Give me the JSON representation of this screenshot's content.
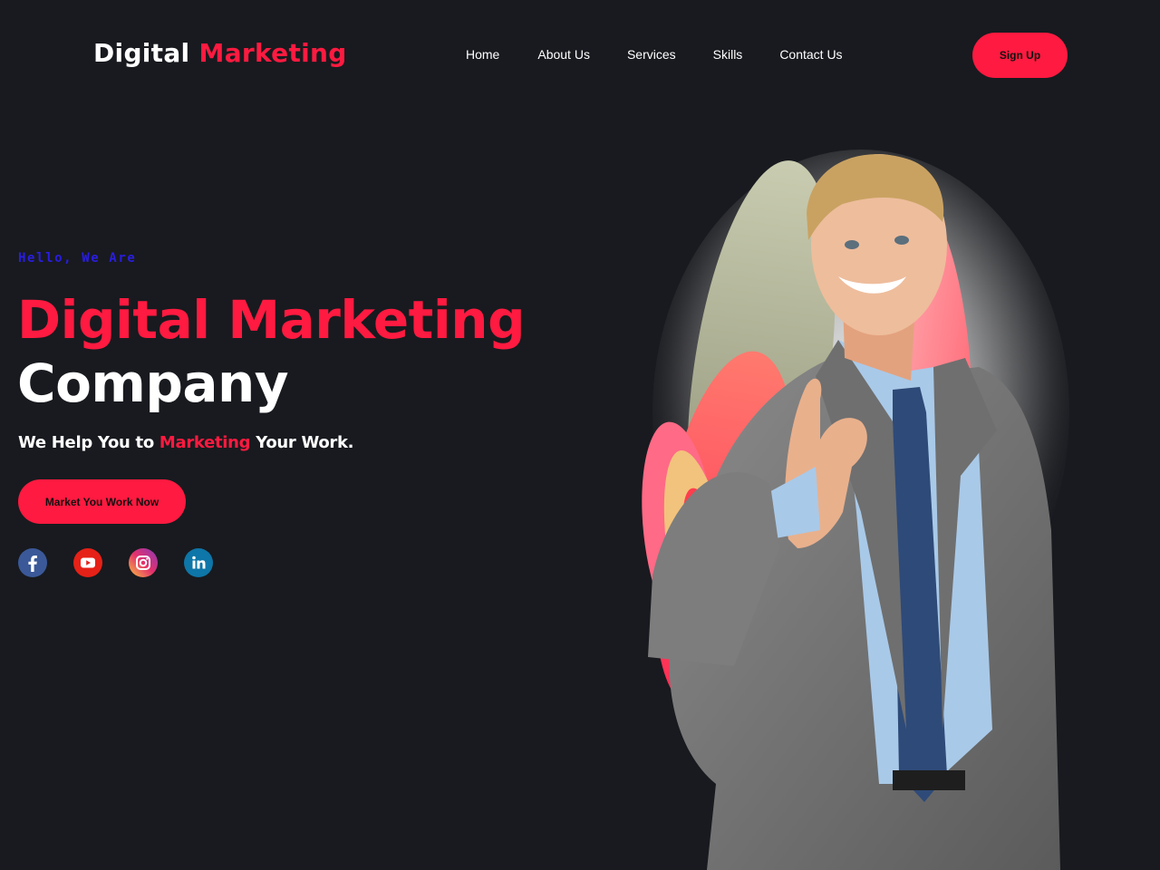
{
  "header": {
    "logo_word1": "Digital",
    "logo_word2": "Marketing",
    "nav": [
      {
        "label": "Home"
      },
      {
        "label": "About Us"
      },
      {
        "label": "Services"
      },
      {
        "label": "Skills"
      },
      {
        "label": "Contact Us"
      }
    ],
    "signup_label": "Sign Up"
  },
  "hero": {
    "eyebrow": "Hello, We Are",
    "title_line1": "Digital Marketing",
    "title_line2": "Company",
    "tagline_prefix": "We Help You to ",
    "tagline_highlight": "Marketing",
    "tagline_suffix": " Your Work.",
    "cta_label": "Market You Work Now",
    "socials": [
      {
        "icon": "facebook-icon",
        "color": "#3b5998"
      },
      {
        "icon": "youtube-icon",
        "color": "#e62117"
      },
      {
        "icon": "instagram-icon",
        "color": "#c13584"
      },
      {
        "icon": "linkedin-icon",
        "color": "#0e76a8"
      }
    ],
    "image": "businessman-ok-gesture-photo"
  },
  "colors": {
    "background": "#181a1f",
    "accent": "#fe1a40",
    "eyebrow": "#2a1de0",
    "text": "#ffffff"
  }
}
